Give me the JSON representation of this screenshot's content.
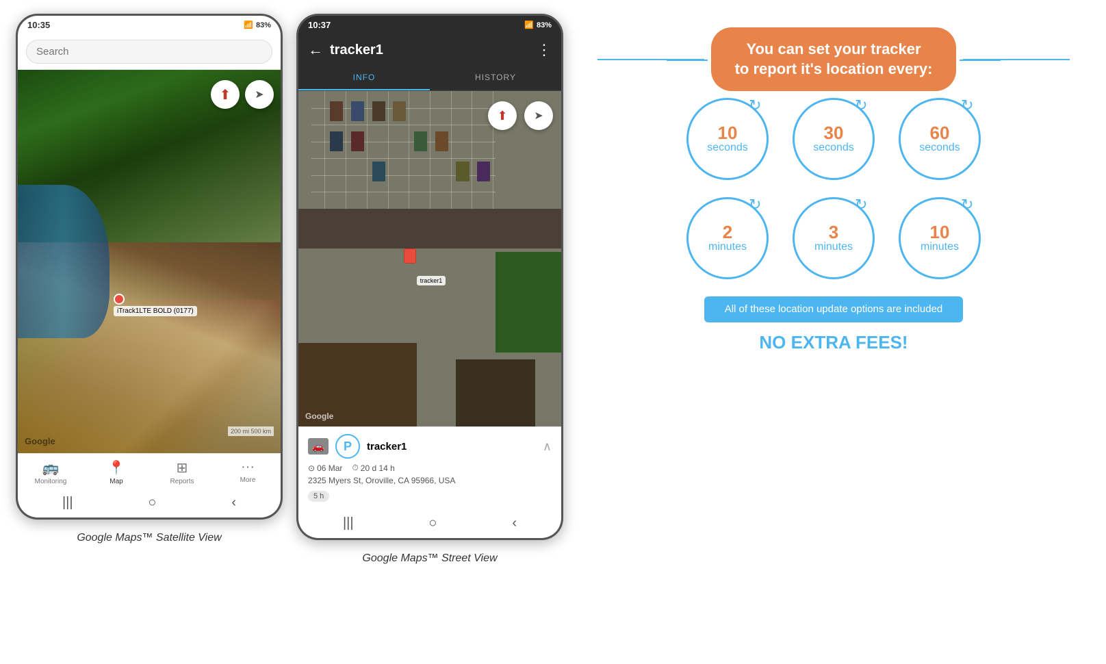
{
  "phones": {
    "map": {
      "time": "10:35",
      "battery": "83%",
      "search_placeholder": "Search",
      "google_watermark": "Google",
      "scale": "200 mi\n500 km",
      "marker_label": "iTrack1LTE BOLD (0177)",
      "compass_symbol": "⊕",
      "nav_items": [
        {
          "label": "Monitoring",
          "icon": "🚌",
          "active": false
        },
        {
          "label": "Map",
          "icon": "📍",
          "active": true
        },
        {
          "label": "Reports",
          "icon": "⊞",
          "active": false
        },
        {
          "label": "More",
          "icon": "···",
          "active": false
        }
      ],
      "controls": [
        "|||",
        "○",
        "<"
      ],
      "label": "Google Maps™ Satellite View"
    },
    "tracker": {
      "time": "10:37",
      "battery": "83%",
      "title": "tracker1",
      "tabs": [
        {
          "label": "INFO",
          "active": true
        },
        {
          "label": "HISTORY",
          "active": false
        }
      ],
      "google_watermark": "Google",
      "tracker_name": "tracker1",
      "date": "06 Mar",
      "duration": "20 d 14 h",
      "address": "2325 Myers St, Oroville, CA 95966, USA",
      "badge": "5 h",
      "callout": "tracker1",
      "controls": [
        "|||",
        "○",
        "<"
      ],
      "label": "Google Maps™ Street View"
    }
  },
  "info_graphic": {
    "headline": "You can set your tracker\nto report it's location every:",
    "line_color": "#4db6f0",
    "circles": [
      {
        "number": "10",
        "unit": "seconds"
      },
      {
        "number": "30",
        "unit": "seconds"
      },
      {
        "number": "60",
        "unit": "seconds"
      },
      {
        "number": "2",
        "unit": "minutes"
      },
      {
        "number": "3",
        "unit": "minutes"
      },
      {
        "number": "10",
        "unit": "minutes"
      }
    ],
    "included_text": "All of these location update options are included",
    "no_fees": "NO EXTRA FEES!"
  }
}
